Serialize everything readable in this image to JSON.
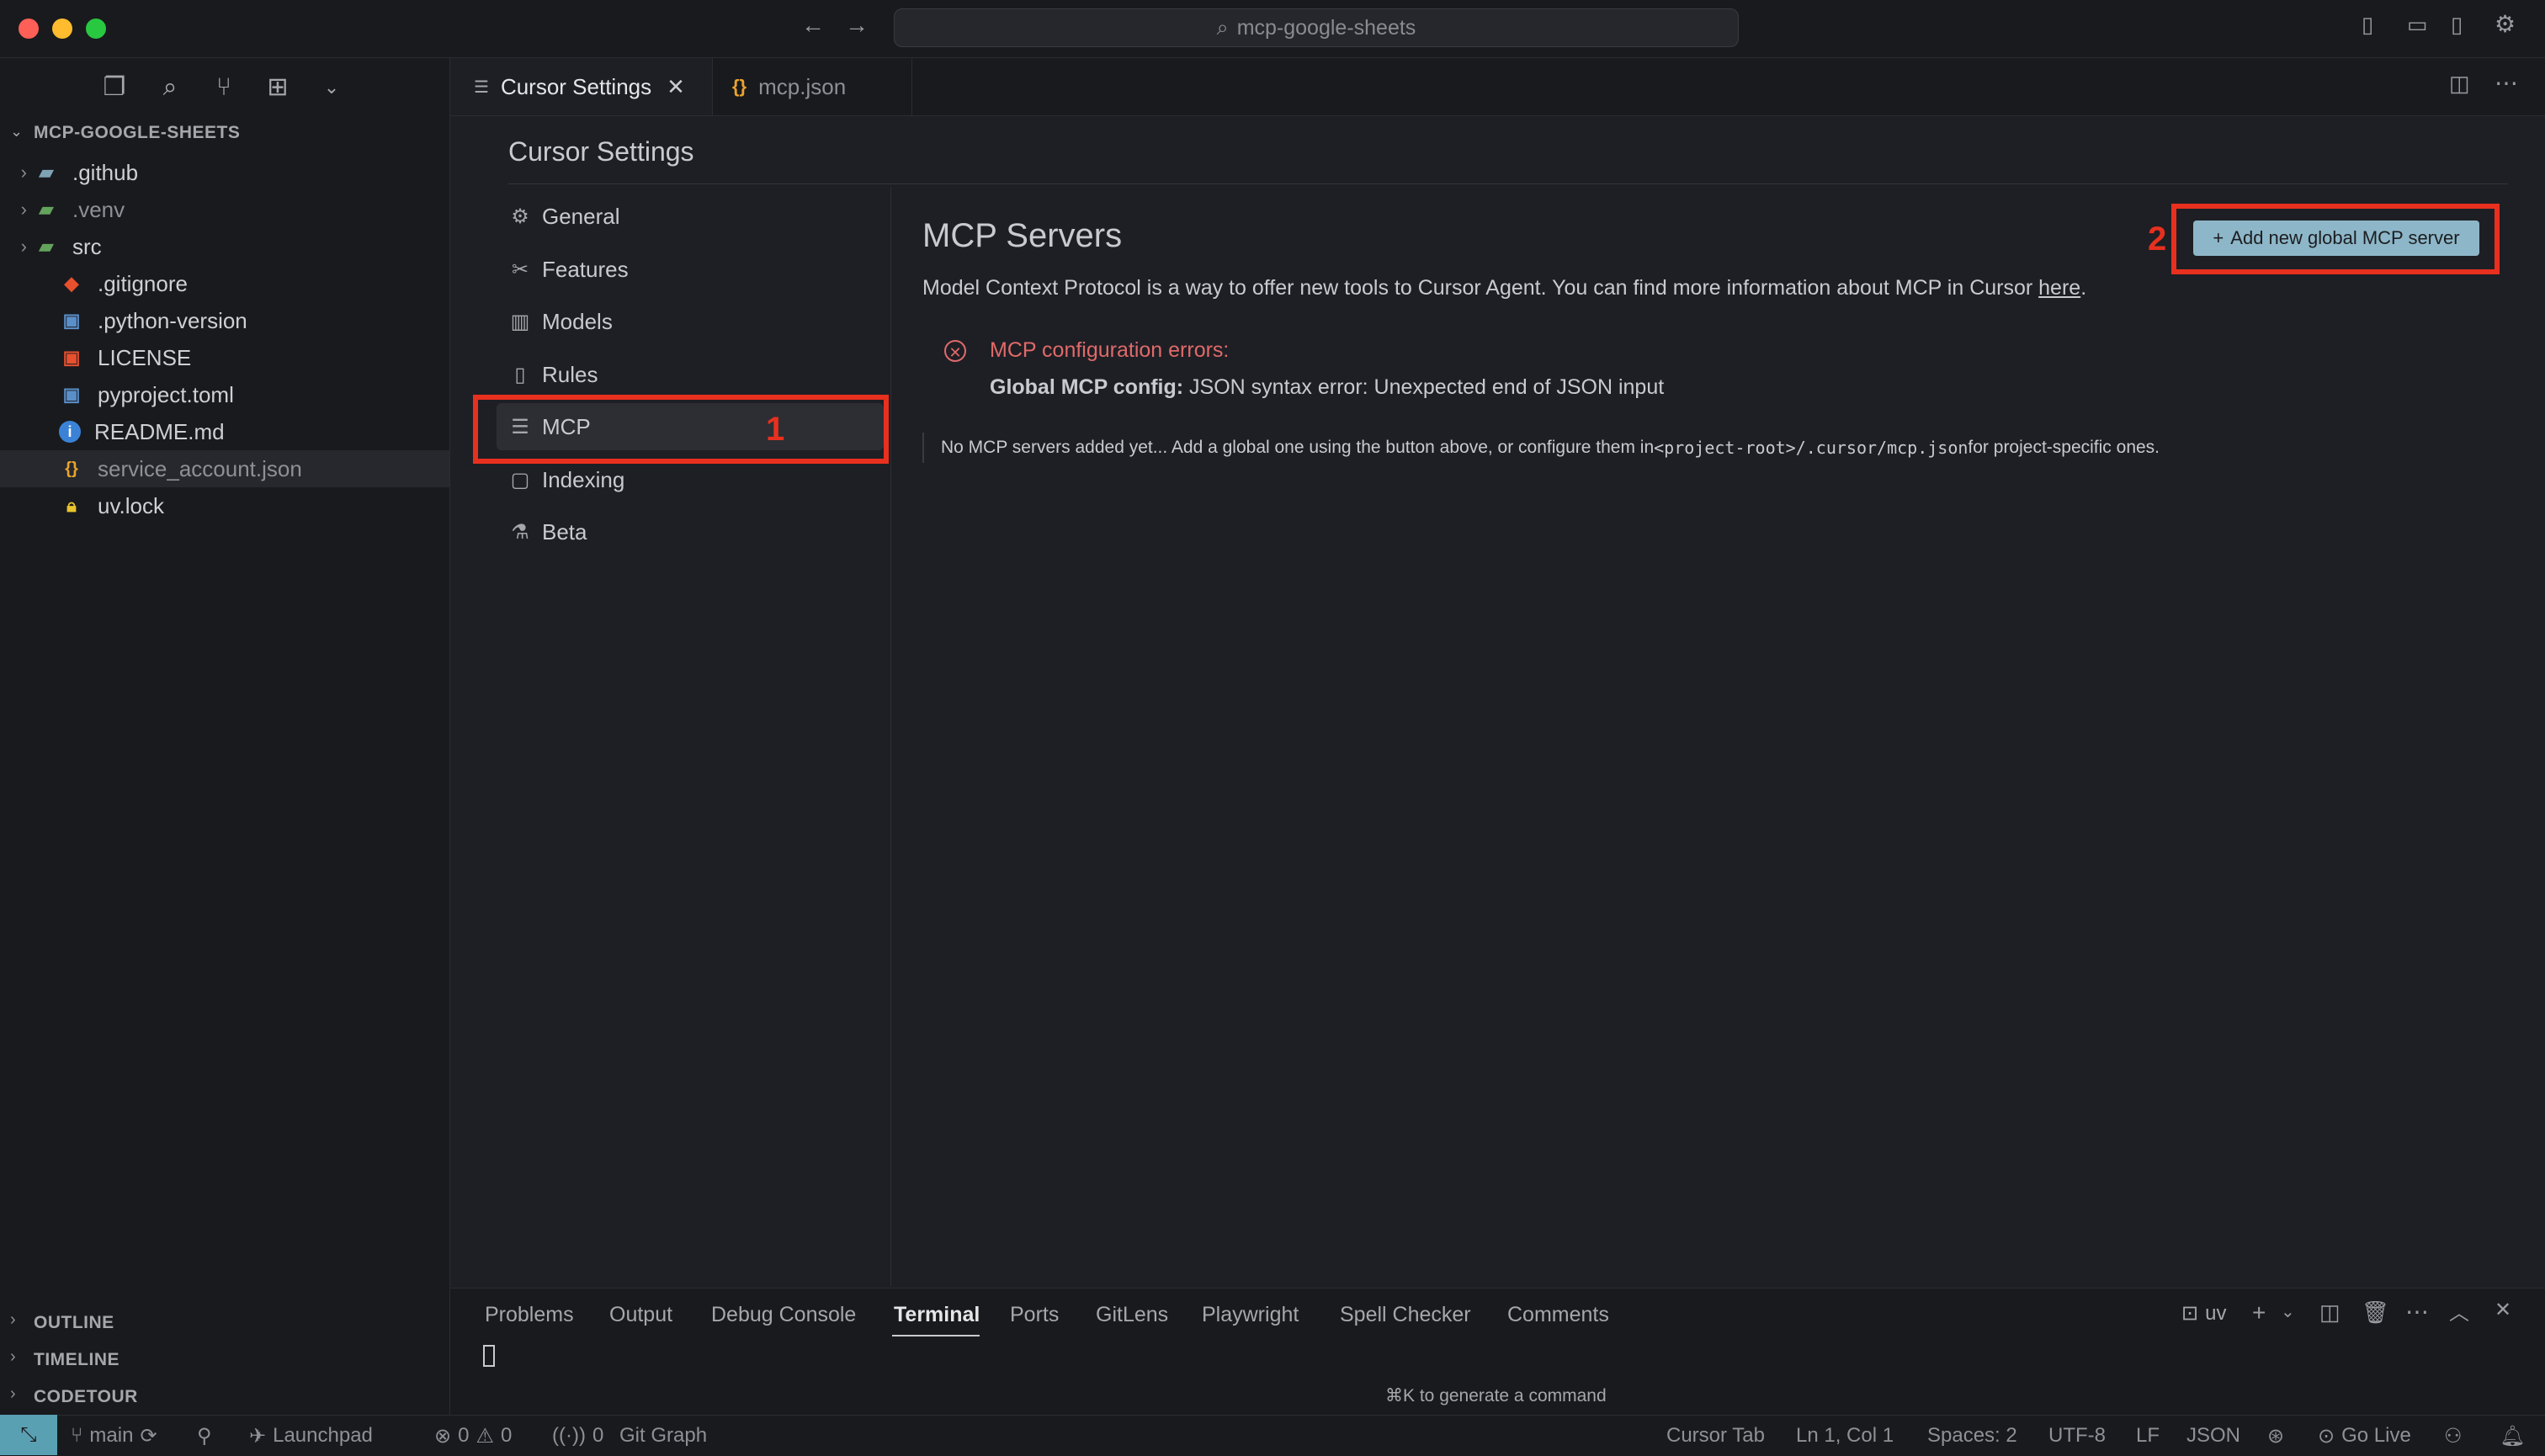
{
  "window": {
    "search_label": "mcp-google-sheets"
  },
  "explorer": {
    "title": "MCP-GOOGLE-SHEETS",
    "items": [
      {
        "label": ".github",
        "type": "folder"
      },
      {
        "label": ".venv",
        "type": "folder"
      },
      {
        "label": "src",
        "type": "folder"
      },
      {
        "label": ".gitignore",
        "type": "file"
      },
      {
        "label": ".python-version",
        "type": "file"
      },
      {
        "label": "LICENSE",
        "type": "file"
      },
      {
        "label": "pyproject.toml",
        "type": "file"
      },
      {
        "label": "README.md",
        "type": "file"
      },
      {
        "label": "service_account.json",
        "type": "file",
        "selected": true
      },
      {
        "label": "uv.lock",
        "type": "file"
      }
    ],
    "sections": [
      "OUTLINE",
      "TIMELINE",
      "CODETOUR"
    ]
  },
  "tabs": [
    {
      "label": "Cursor Settings",
      "active": true
    },
    {
      "label": "mcp.json",
      "active": false
    }
  ],
  "settings": {
    "title": "Cursor Settings",
    "nav": [
      "General",
      "Features",
      "Models",
      "Rules",
      "MCP",
      "Indexing",
      "Beta"
    ],
    "active_nav": "MCP"
  },
  "mcp": {
    "title": "MCP Servers",
    "description_prefix": "Model Context Protocol is a way to offer new tools to Cursor Agent. You can find more information about MCP in Cursor ",
    "description_link": "here",
    "description_suffix": ".",
    "add_button": "Add new global MCP server",
    "error_title": "MCP configuration errors:",
    "error_label": "Global MCP config:",
    "error_text": " JSON syntax error: Unexpected end of JSON input",
    "empty_prefix": "No MCP servers added yet... Add a global one using the button above, or configure them in ",
    "empty_code": "<project-root>/.cursor/mcp.json",
    "empty_suffix": " for project-specific ones."
  },
  "annotations": {
    "label_1": "1",
    "label_2": "2",
    "color": "#e8301e"
  },
  "panel": {
    "tabs": [
      "Problems",
      "Output",
      "Debug Console",
      "Terminal",
      "Ports",
      "GitLens",
      "Playwright",
      "Spell Checker",
      "Comments"
    ],
    "active_tab": "Terminal",
    "terminal_name": "uv",
    "hint": "⌘K to generate a command"
  },
  "statusbar": {
    "branch": "main",
    "launchpad": "Launchpad",
    "errors": "0",
    "warnings": "0",
    "ports": "0",
    "git_graph": "Git Graph",
    "cursor_tab": "Cursor Tab",
    "position": "Ln 1, Col 1",
    "spaces": "Spaces: 2",
    "encoding": "UTF-8",
    "eol": "LF",
    "language": "JSON",
    "go_live": "Go Live"
  }
}
